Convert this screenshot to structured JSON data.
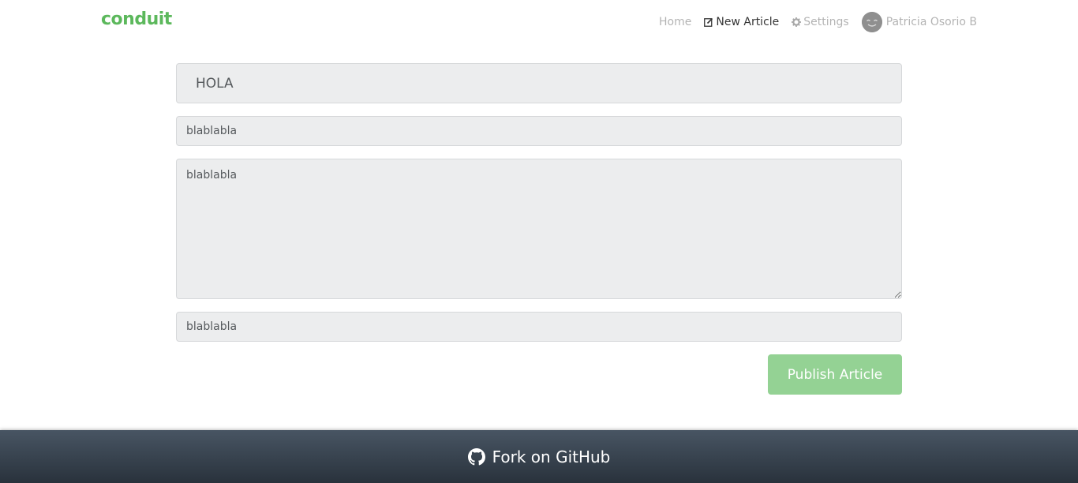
{
  "brand": {
    "name": "conduit",
    "color": "#5cb85c"
  },
  "nav": {
    "home": "Home",
    "new_article": "New Article",
    "new_article_icon": "edit-icon",
    "settings": "Settings",
    "settings_icon": "gear-icon",
    "user": "Patricia Osorio B"
  },
  "editor": {
    "title_value": "HOLA",
    "description_value": "blablabla",
    "body_value": "blablabla",
    "tags_value": "blablabla",
    "publish_label": "Publish Article",
    "publish_color": "#94d294"
  },
  "footer": {
    "label": "Fork on GitHub",
    "icon": "github-icon"
  }
}
